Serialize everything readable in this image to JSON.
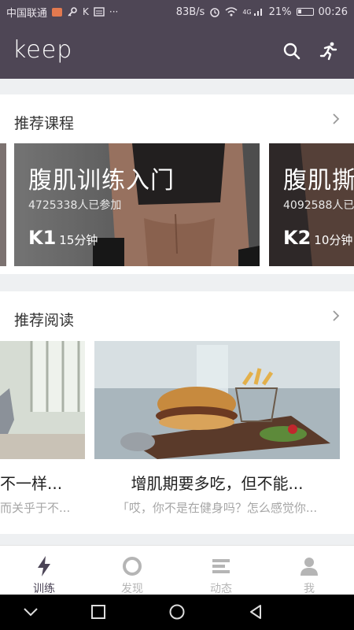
{
  "status_bar": {
    "carrier": "中国联通",
    "indicators": "K",
    "dots": "···",
    "speed": "83B/s",
    "network": "4G",
    "battery": "21%",
    "time": "00:26"
  },
  "app_bar": {
    "logo": "keep",
    "icons": [
      "search-icon",
      "run-icon"
    ]
  },
  "recommended_courses": {
    "title": "推荐课程",
    "items": [
      {
        "title": "腹肌训练入门",
        "participants": "4725338人已参加",
        "level": "K1",
        "duration": "15分钟"
      },
      {
        "title": "腹肌撕",
        "participants": "4092588人已",
        "level": "K2",
        "duration": "10分钟"
      }
    ]
  },
  "recommended_reading": {
    "title": "推荐阅读",
    "items": [
      {
        "title": "不一样...",
        "subtitle": "而关乎于不..."
      },
      {
        "title": "增肌期要多吃，但不能...",
        "subtitle": "「哎，你不是在健身吗？怎么感觉你..."
      }
    ]
  },
  "tab_bar": {
    "tabs": [
      {
        "label": "训练",
        "icon": "lightning-icon",
        "active": true
      },
      {
        "label": "发现",
        "icon": "circle-icon",
        "active": false
      },
      {
        "label": "动态",
        "icon": "feed-icon",
        "active": false
      },
      {
        "label": "我",
        "icon": "person-icon",
        "active": false
      }
    ]
  },
  "colors": {
    "header": "#4e4655",
    "tab_active": "#4b4456",
    "tab_inactive": "#b5b5b5"
  }
}
